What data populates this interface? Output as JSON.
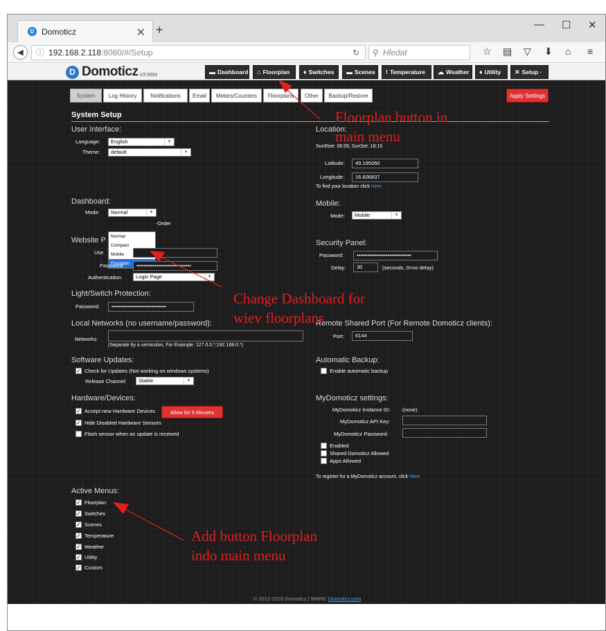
{
  "browser": {
    "tab_title": "Domoticz",
    "url_info_icon": "ⓘ",
    "url_host": "192.168.2.118",
    "url_rest": ":8080/#/Setup",
    "search_placeholder": "Hledat"
  },
  "app": {
    "logo": "Domoticz",
    "version": "V3.5691",
    "menu": [
      {
        "label": "Dashboard",
        "icon": "▬"
      },
      {
        "label": "Floorplan",
        "icon": "⌂"
      },
      {
        "label": "Switches",
        "icon": "♦"
      },
      {
        "label": "Scenes",
        "icon": "▬"
      },
      {
        "label": "Temperature",
        "icon": "ǃ"
      },
      {
        "label": "Weather",
        "icon": "☁"
      },
      {
        "label": "Utility",
        "icon": "♦"
      },
      {
        "label": "Setup ·",
        "icon": "✕"
      }
    ],
    "subtabs": [
      "System",
      "Log History",
      "Notifications",
      "Email",
      "Meters/Counters",
      "Floorplans",
      "Other",
      "Backup/Restore"
    ],
    "apply_label": "Apply Settings",
    "page_title": "System Setup"
  },
  "ui": {
    "section": "User Interface:",
    "language_label": "Language:",
    "language_value": "English",
    "theme_label": "Theme:",
    "theme_value": "default"
  },
  "location": {
    "section": "Location:",
    "sun": "SunRise: 06:59, SunSet: 18:15",
    "lat_label": "Latitude:",
    "lat_value": "49.195060",
    "lon_label": "Longitude:",
    "lon_value": "16.606837",
    "find_text": "To find your location click ",
    "find_link": "Here"
  },
  "dashboard": {
    "section": "Dashboard:",
    "mode_label": "Mode:",
    "mode_value": "Normal",
    "order_text": "-Order",
    "options": [
      "Normal",
      "Compact",
      "Mobile",
      "Floorplan"
    ]
  },
  "mobile": {
    "section": "Mobile:",
    "mode_label": "Mode:",
    "mode_value": "Mobile"
  },
  "website": {
    "section": "Website P",
    "user_label": "Use",
    "password_label": "Password:",
    "password_value": "••••••••••••••••••••••••••••••",
    "auth_label": "Authentication:",
    "auth_value": "Login Page"
  },
  "security": {
    "section": "Security Panel:",
    "password_label": "Password:",
    "password_value": "••••••••••••••••••••••••••••••",
    "delay_label": "Delay:",
    "delay_value": "30",
    "delay_note": "(seconds, 0=no delay)"
  },
  "lightswitch": {
    "section": "Light/Switch Protection:",
    "password_label": "Password:",
    "password_value": "••••••••••••••••••••••••••••••"
  },
  "localnet": {
    "section": "Local Networks (no username/password):",
    "networks_label": "Networks:",
    "note": "(Separate by a semicolon, For Example: 127.0.0.*;192.168.0.*)"
  },
  "remote": {
    "section": "Remote Shared Port (For Remote Domoticz clients):",
    "port_label": "Port:",
    "port_value": "6144"
  },
  "software": {
    "section": "Software Updates:",
    "check_label": "Check for Updates (Not working on windows systems)",
    "channel_label": "Release Channel:",
    "channel_value": "Stable"
  },
  "backup": {
    "section": "Automatic Backup:",
    "enable_label": "Enable automatic backup"
  },
  "hardware": {
    "section": "Hardware/Devices:",
    "accept_label": "Accept new Hardware Devices",
    "allow_button": "Allow for 5 Minutes",
    "hide_label": "Hide Disabled Hardware Sensors",
    "flash_label": "Flash sensor when an update is received"
  },
  "mydomoticz": {
    "section": "MyDomoticz settings:",
    "instance_label": "MyDomoticz Instance ID:",
    "instance_value": "(none)",
    "apikey_label": "MyDomoticz API Key:",
    "password_label": "MyDomoticz Password:",
    "enabled_label": "Enabled",
    "shared_label": "Shared Domoticz Allowed",
    "apps_label": "Apps Allowed",
    "register_text": "To register for a MyDomoticz account, click ",
    "register_link": "Here"
  },
  "active_menus": {
    "section": "Active Menus:",
    "items": [
      "Floorplan",
      "Switches",
      "Scenes",
      "Temperature",
      "Weather",
      "Utility",
      "Custom"
    ]
  },
  "footer": {
    "text": "© 2012-2016 Domoticz | WWW: ",
    "link": "Domoticz.com"
  },
  "annotations": {
    "a1_line1": "Floorplan button in",
    "a1_line2": "main menu",
    "a2_line1": "Change Dashboard for",
    "a2_line2": "wiev floorplans",
    "a3_line1": "Add button Floorplan",
    "a3_line2": "indo main menu",
    "color": "#e31f1f"
  }
}
